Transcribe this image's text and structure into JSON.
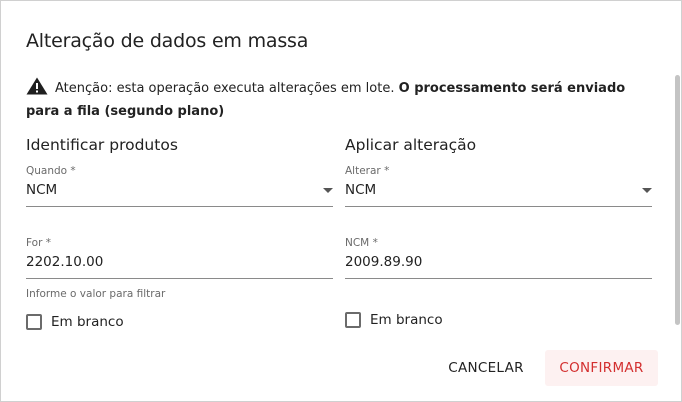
{
  "dialog": {
    "title": "Alteração de dados em massa",
    "warning": {
      "icon": "warning-icon",
      "normal_text": "Atenção: esta operação executa alterações em lote. ",
      "bold_text": "O processamento será enviado para a fila (segundo plano)"
    },
    "left_column": {
      "title": "Identificar produtos",
      "when_field": {
        "label": "Quando *",
        "value": "NCM"
      },
      "for_field": {
        "label": "For *",
        "value": "2202.10.00",
        "helper": "Informe o valor para filtrar"
      },
      "blank_checkbox": {
        "label": "Em branco",
        "checked": false
      }
    },
    "right_column": {
      "title": "Aplicar alteração",
      "change_field": {
        "label": "Alterar *",
        "value": "NCM"
      },
      "ncm_field": {
        "label": "NCM *",
        "value": "2009.89.90"
      },
      "blank_checkbox": {
        "label": "Em branco",
        "checked": false
      }
    },
    "actions": {
      "cancel": "CANCELAR",
      "confirm": "CONFIRMAR"
    },
    "colors": {
      "accent": "#d32f2f",
      "confirm_bg": "#fdf1f1"
    }
  }
}
